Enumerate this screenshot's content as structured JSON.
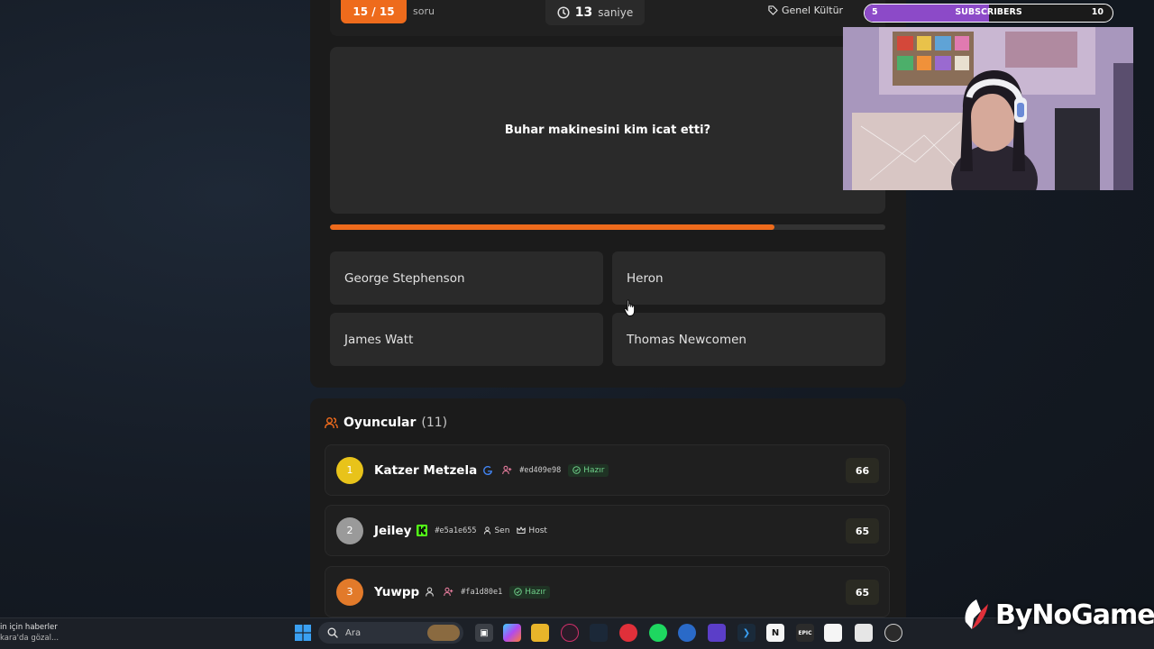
{
  "quiz": {
    "counter": "15 / 15",
    "counter_label": "soru",
    "timer_value": "13",
    "timer_unit": "saniye",
    "category": "Genel Kültür",
    "question": "Buhar makinesini kim icat etti?",
    "progress": 0.8,
    "answers": [
      {
        "label": "George Stephenson"
      },
      {
        "label": "Heron"
      },
      {
        "label": "James Watt"
      },
      {
        "label": "Thomas Newcomen"
      }
    ],
    "accent_color": "#ee6b1c"
  },
  "players": {
    "title": "Oyuncular",
    "count": "(11)",
    "list": [
      {
        "rank": "1",
        "name": "Katzer Metzela",
        "id": "#ed409e98",
        "tags": [
          "Hazır"
        ],
        "score": "66",
        "rank_color": "#e8c31a"
      },
      {
        "rank": "2",
        "name": "Jeiley",
        "id": "#e5a1e655",
        "tags": [
          "Sen",
          "Host"
        ],
        "score": "65",
        "rank_color": "#9a9a9a"
      },
      {
        "rank": "3",
        "name": "Yuwpp",
        "id": "#fa1d80e1",
        "tags": [
          "Hazır"
        ],
        "score": "65",
        "rank_color": "#e27a2a"
      }
    ]
  },
  "stream": {
    "subs_current": "5",
    "subs_label": "SUBSCRIBERS",
    "subs_goal": "10",
    "subs_progress": 0.5
  },
  "taskbar": {
    "news_line1": "in için haberler",
    "news_line2": "kara'da gözal...",
    "search_placeholder": "Ara"
  },
  "brand": {
    "name": "ByNoGame"
  }
}
